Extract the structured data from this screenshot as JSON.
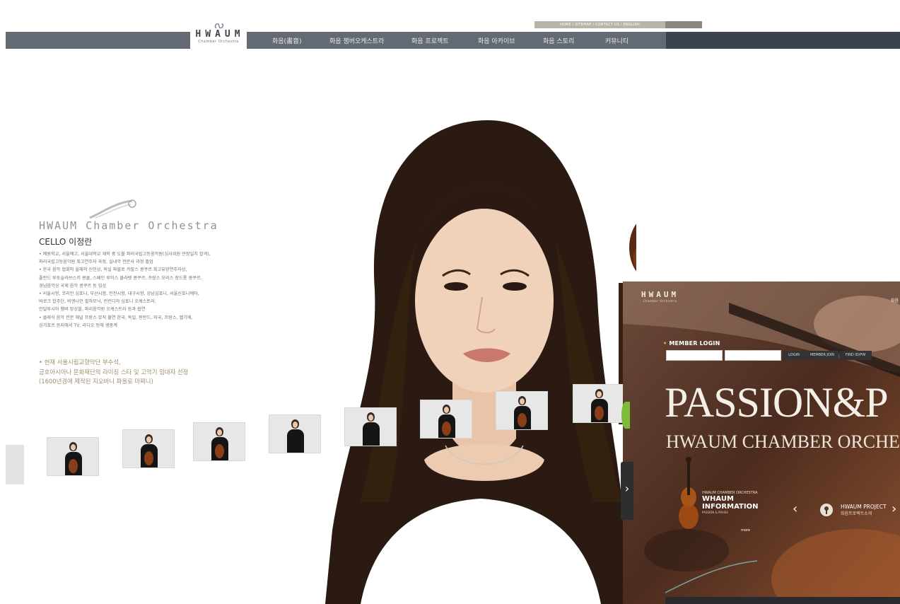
{
  "utility": {
    "links": "HOME / SITEMAP / CONTACT US / ENGLISH"
  },
  "logo": {
    "mark": "ᔓ",
    "word": "HWAUM",
    "sub": "Chamber Orchestra"
  },
  "nav": {
    "items": [
      "화음(畵音)",
      "화음 챔버오케스트라",
      "화음 프로젝트",
      "화음 아카이브",
      "화음 스토리",
      "커뮤니티"
    ]
  },
  "profile": {
    "brand": "HWAUM Chamber Orchestra",
    "role": "CELLO 이정란",
    "bullets": [
      "• 예원학교, 서울예고, 서울대학교 재학 중 도불 파리국립고등음악원(심사위원 만장일치 합격),",
      "  파리국립고등음악원 최고연주자 과정, 실내악 전문사 과정 졸업",
      "• 한국 음악 협회의 올해의 신인상, 독일 파블로 카잘스 콩쿠르 최고유망연주자상,",
      "  폴란드 루토슬라브스키 콩쿨, 스페인 루이스 클라렛 콩쿠르, 프랑스 모리스 장드롱 콩쿠르,",
      "  경남음악상 국제 음악 콩쿠르 등 입상",
      "• 서울시향, 코리안 심포니, 부산시향, 인천시향, 대구시향, 강남심포니, 서울신포니에타,",
      "  바로크 합주단, 비엔나인 필하모닉, 린린디아 심포니 오케스트라,",
      "  안달루시아 챔버 앙상블, 파리음악원 오케스트라 등과 협연",
      "• 클래식 음악 전문 채널 프랑스 뮤직 출연 한국, 독일, 핀란드, 미국, 프랑스, 벨기에,",
      "  싱가포르 등지에서 TV, 라디오 등에 생중계"
    ],
    "current": [
      "• 현재 서울시립교향악단 부수석,",
      "금호아시아나 문화재단의 라이징 스타 및 고악기 임대자 선정",
      "(1600년경에 제작된 지오바니 파올로 마찌니)"
    ]
  },
  "overlay": {
    "logo_word": "HWAUM",
    "logo_sub": "Chamber Orchestra",
    "top_right": "화음",
    "login_label": "MEMBER LOGIN",
    "buttons": [
      "LOGIN",
      "MEMBER JOIN",
      "FIND ID/PW"
    ],
    "headline": "PASSION&P",
    "subline": "HWAUM CHAMBER ORCHEST",
    "info_small": "HWAUM CHAMBER ORCHESTRA",
    "info_big1": "WHAUM",
    "info_big2": "INFORMATION",
    "info_tiny": "PASSION & PRAISE",
    "more": "more",
    "project_title": "HWAUM PROJECT",
    "project_sub": "화음프로젝트소개",
    "arrow_left": "‹",
    "arrow_right": "›"
  },
  "side_handle": {
    "glyph": "›"
  }
}
